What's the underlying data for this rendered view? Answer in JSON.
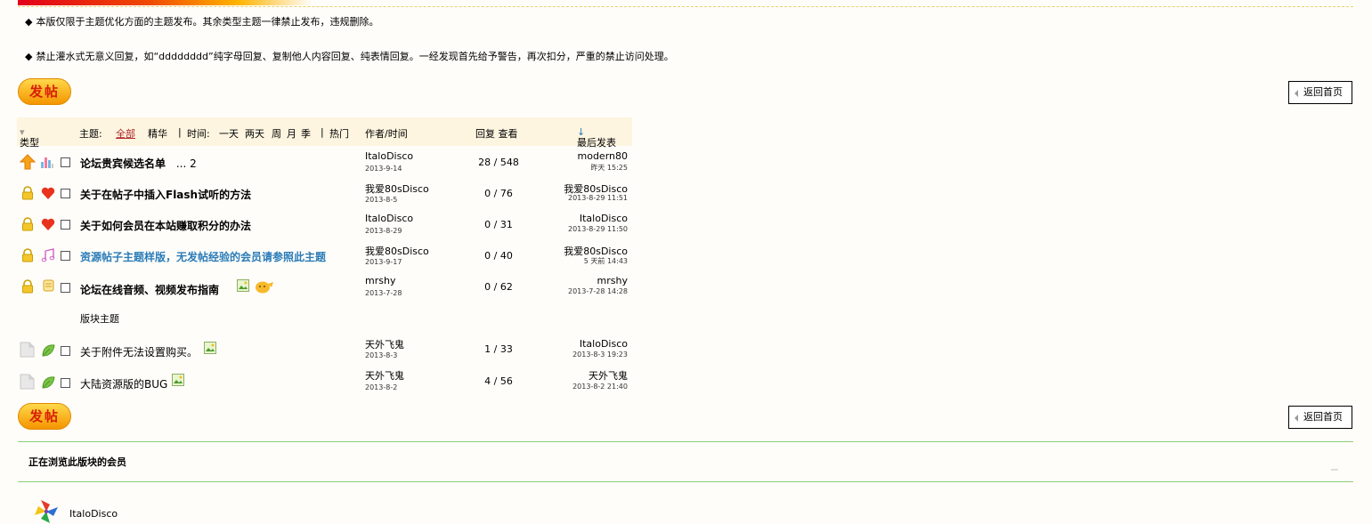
{
  "notices": [
    "本版仅限于主题优化方面的主题发布。其余类型主题一律禁止发布，违规删除。",
    "禁止灌水式无意义回复，如“dddddddd”纯字母回复、复制他人内容回复、纯表情回复。一经发现首先给予警告，再次扣分，严重的禁止访问处理。"
  ],
  "notice_bullet": "◆",
  "post_button": "发帖",
  "home_button": "返回首页",
  "header": {
    "type": "类型",
    "type_arrow": "▾",
    "subject": "主题:",
    "all": "全部",
    "digest": "精华",
    "sep1": "|",
    "time": "时间:",
    "day": "一天",
    "twodays": "两天",
    "week": "周",
    "month": "月",
    "quarter": "季",
    "sep2": "|",
    "hot": "热门",
    "author": "作者/时间",
    "reply_view": "回复 查看",
    "lastpost": "最后发表",
    "lastpost_arrow": "↓"
  },
  "threads": [
    {
      "icon": "arrow-up-icon",
      "type_icon": "chart-icon",
      "title": "论坛贵宾候选名单",
      "style": "bold",
      "suffix": "... 2",
      "author": "ItaloDisco",
      "date": "2013-9-14",
      "counts": "28 / 548",
      "last_user": "modern80",
      "last_time": "昨天 15:25"
    },
    {
      "icon": "lock-icon",
      "type_icon": "heart-icon",
      "title": "关于在帖子中插入Flash试听的方法",
      "style": "bold",
      "suffix": "",
      "author": "我爱80sDisco",
      "date": "2013-8-5",
      "counts": "0 / 76",
      "last_user": "我爱80sDisco",
      "last_time": "2013-8-29 11:51"
    },
    {
      "icon": "lock-icon",
      "type_icon": "heart-icon",
      "title": "关于如何会员在本站赚取积分的办法",
      "style": "bold",
      "suffix": "",
      "author": "ItaloDisco",
      "date": "2013-8-29",
      "counts": "0 / 31",
      "last_user": "ItaloDisco",
      "last_time": "2013-8-29 11:50"
    },
    {
      "icon": "lock-icon",
      "type_icon": "music-icon",
      "title": "资源帖子主题样版，无发帖经验的会员请参照此主题",
      "style": "blue",
      "suffix": "",
      "author": "我爱80sDisco",
      "date": "2013-9-17",
      "counts": "0 / 40",
      "last_user": "我爱80sDisco",
      "last_time": "5 天前 14:43"
    },
    {
      "icon": "lock-icon",
      "type_icon": "scroll-icon",
      "title": "论坛在线音频、视频发布指南",
      "style": "bold",
      "suffix": "",
      "author": "mrshy",
      "date": "2013-7-28",
      "counts": "0 / 62",
      "last_user": "mrshy",
      "last_time": "2013-7-28 14:28"
    }
  ],
  "section_label": "版块主题",
  "normal_threads": [
    {
      "title": "关于附件无法设置购买。",
      "author": "天外飞鬼",
      "date": "2013-8-3",
      "counts": "1 / 33",
      "last_user": "ItaloDisco",
      "last_time": "2013-8-3 19:23"
    },
    {
      "title": "大陆资源版的BUG",
      "author": "天外飞鬼",
      "date": "2013-8-2",
      "counts": "4 / 56",
      "last_user": "天外飞鬼",
      "last_time": "2013-8-2 21:40"
    }
  ],
  "browsing_title": "正在浏览此版块的会员",
  "members": [
    "ItaloDisco"
  ],
  "colors": {
    "accent": "#b0262b",
    "link_blue": "#2a7bb8",
    "header_bg": "#fdf5e0",
    "divider": "#8fd07a"
  }
}
